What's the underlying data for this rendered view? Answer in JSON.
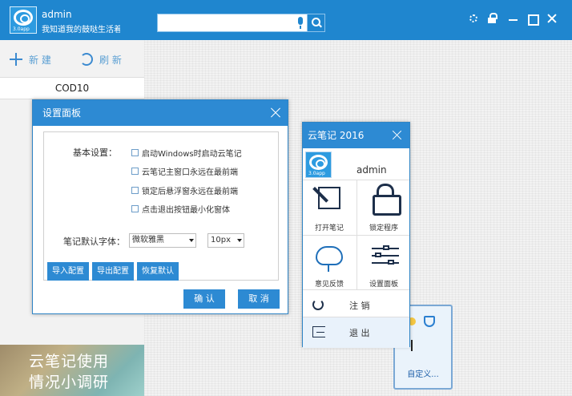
{
  "header": {
    "username": "admin",
    "motto": "我知道我的鼓哒生活着...",
    "search_placeholder": ""
  },
  "toolbar": {
    "new_label": "新 建",
    "refresh_label": "刷 新"
  },
  "notes_list": {
    "items": [
      {
        "label": "COD10"
      }
    ]
  },
  "survey_banner": {
    "line1": "云笔记使用",
    "line2": "情况小调研"
  },
  "settings_dialog": {
    "title": "设置面板",
    "basic_label": "基本设置：",
    "options": [
      {
        "label": "启动Windows时启动云笔记",
        "checked": false
      },
      {
        "label": "云笔记主窗口永远在最前端",
        "checked": false
      },
      {
        "label": "锁定后悬浮窗永远在最前端",
        "checked": false
      },
      {
        "label": "点击退出按钮最小化窗体",
        "checked": false
      }
    ],
    "font_label": "笔记默认字体：",
    "font_family": "微软雅黑",
    "font_size": "10px",
    "import_label": "导入配置",
    "export_label": "导出配置",
    "restore_label": "恢复默认",
    "confirm_label": "确 认",
    "cancel_label": "取 消"
  },
  "cloud_panel": {
    "title": "云笔记 2016",
    "username": "admin",
    "logo_text": "3.0app",
    "tiles": [
      {
        "label": "打开笔记"
      },
      {
        "label": "锁定程序"
      },
      {
        "label": "意见反馈"
      },
      {
        "label": "设置面板"
      }
    ],
    "logout_label": "注 销",
    "quit_label": "退 出"
  },
  "customize_panel": {
    "label": "自定义..."
  },
  "colors": {
    "primary": "#1f86cf",
    "accent": "#2d8ad3",
    "button_text": "#ffffff"
  }
}
